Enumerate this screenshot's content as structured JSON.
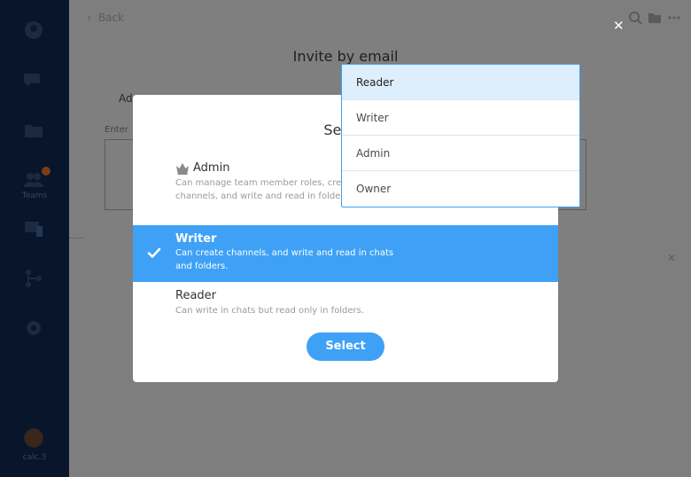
{
  "sidebar": {
    "teams_label": "Teams",
    "user_label": "calc.3"
  },
  "background": {
    "back_label": "Back"
  },
  "invite_dialog": {
    "title": "Invite by email",
    "label_partial": "Ad",
    "enter_partial": "Enter",
    "close_icon": "close-icon"
  },
  "role_modal": {
    "title": "Select",
    "options": [
      {
        "name": "Admin",
        "description": "Can manage team member roles, cre and channels, and write and read in folders.",
        "icon": "crown-icon"
      },
      {
        "name": "Writer",
        "description": "Can create channels, and write and read in chats and folders.",
        "selected": true
      },
      {
        "name": "Reader",
        "description": "Can write in chats but read only in folders."
      }
    ],
    "select_button": "Select"
  },
  "dropdown": {
    "options": [
      "Reader",
      "Writer",
      "Admin",
      "Owner"
    ],
    "highlighted": "Reader"
  },
  "colors": {
    "accent": "#3ea1f5",
    "sidebar": "#08152a",
    "overlay": "#7e7e7e"
  }
}
